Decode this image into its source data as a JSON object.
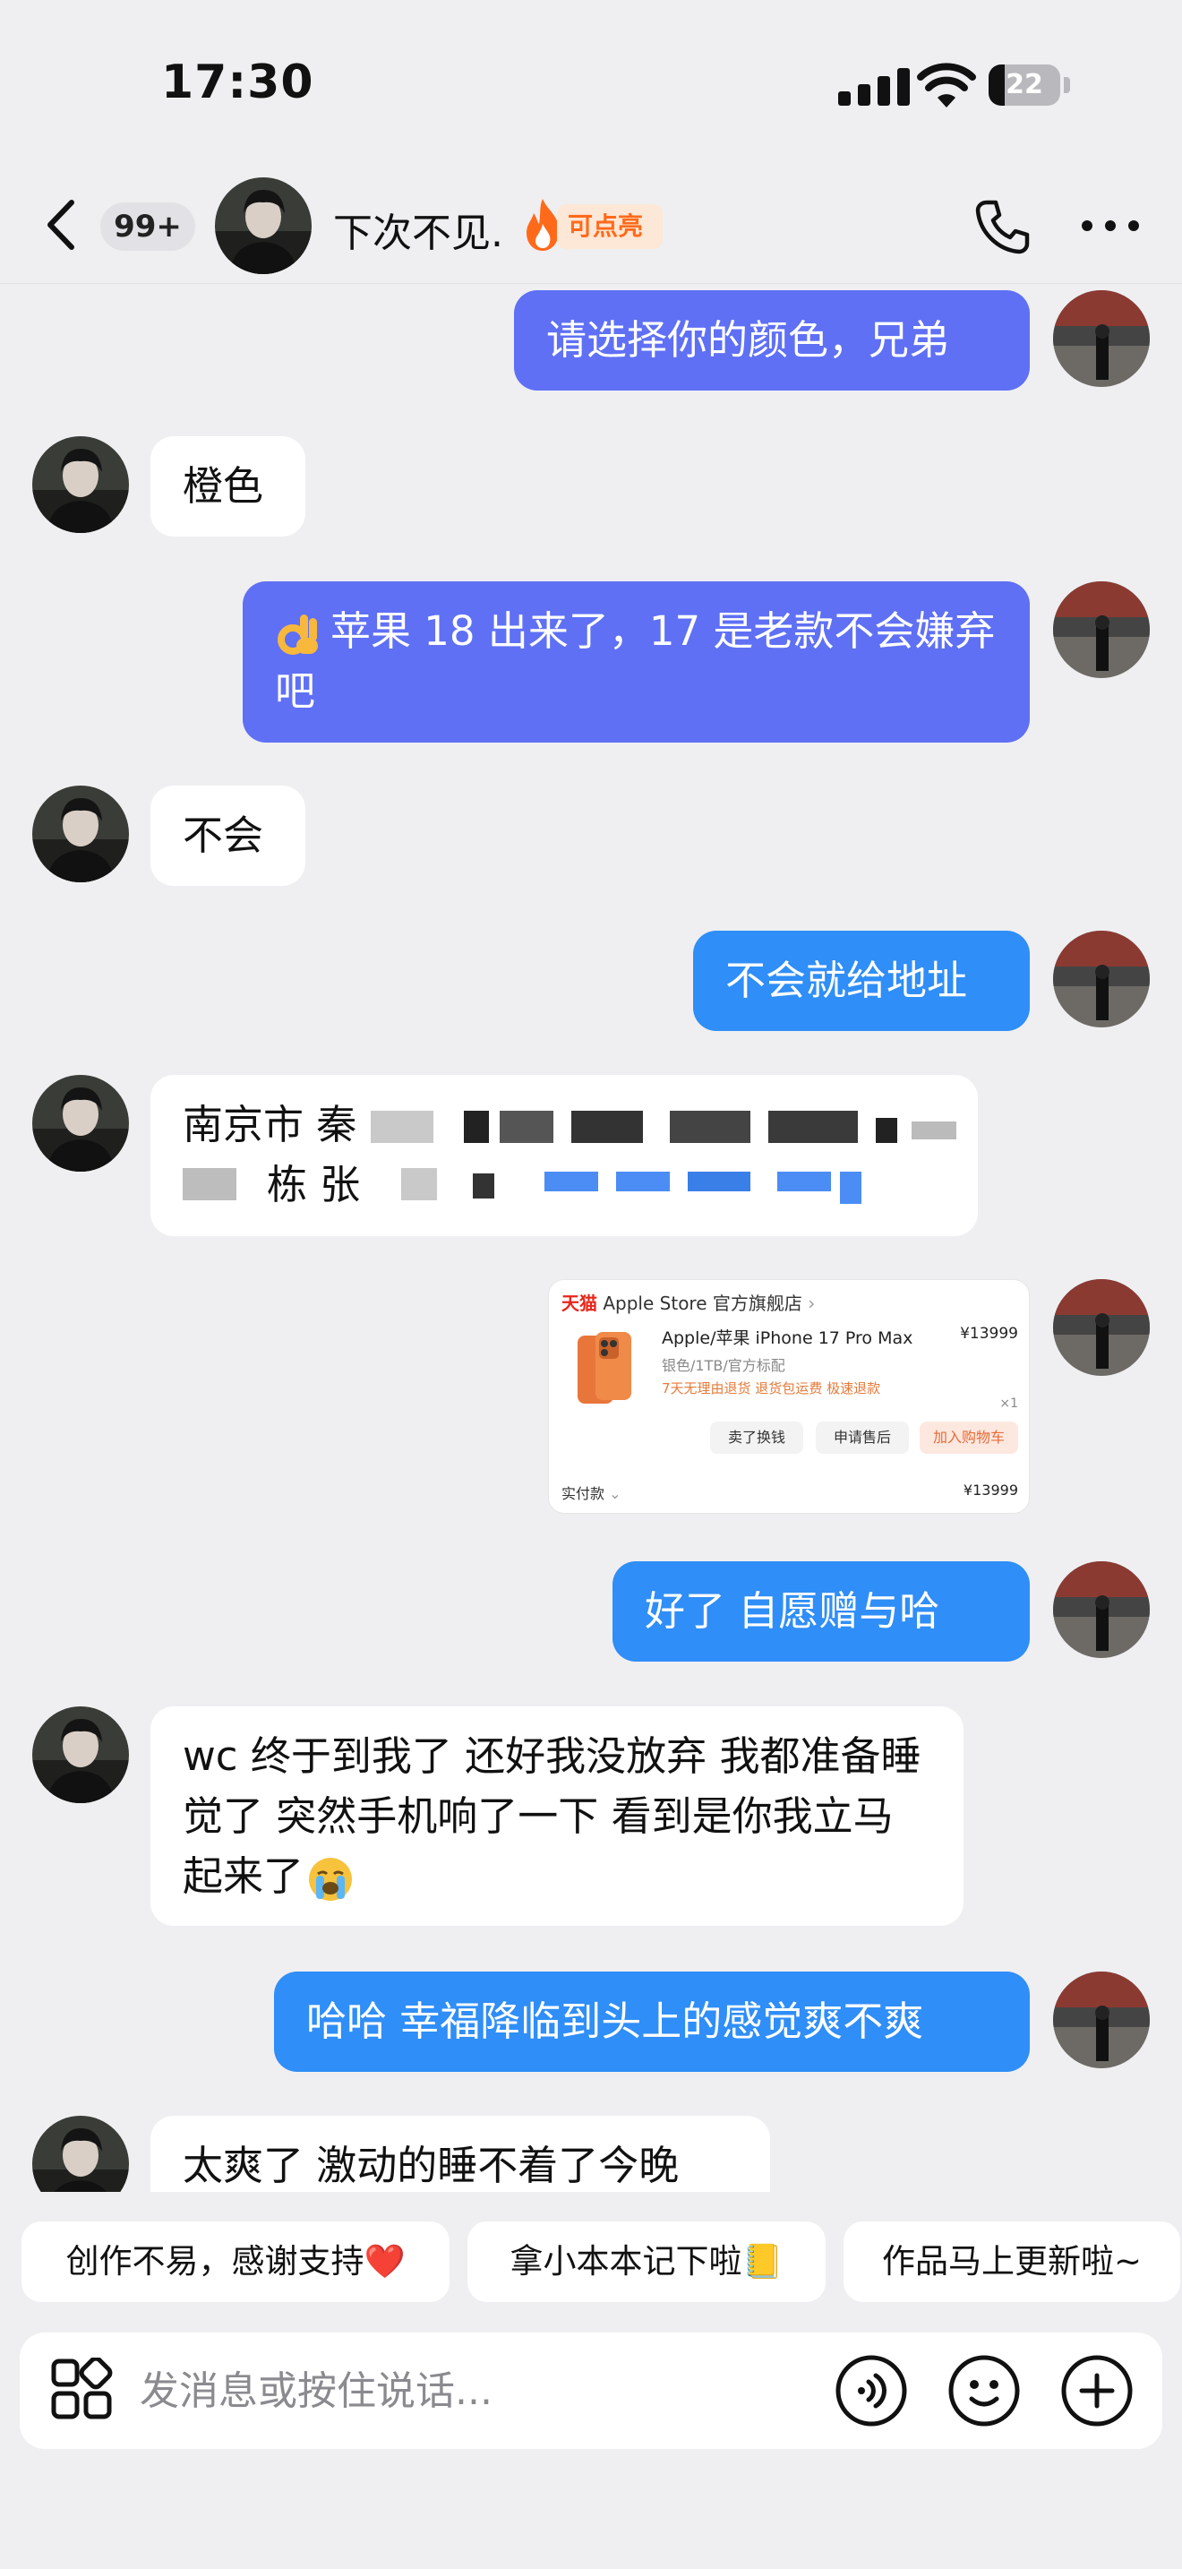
{
  "status_bar": {
    "time": "17:30",
    "battery": "22",
    "battery_level": 0.22
  },
  "header": {
    "unread_count": "99+",
    "contact_name": "下次不见.",
    "streak_label": "可点亮"
  },
  "messages": [
    {
      "side": "out",
      "text": "请选择你的颜色，兄弟"
    },
    {
      "side": "in",
      "text": "橙色"
    },
    {
      "side": "out",
      "emoji": "ok-hand",
      "text": "苹果 18 出来了，17 是老款不会嫌弃吧"
    },
    {
      "side": "in",
      "text": "不会"
    },
    {
      "side": "out",
      "text": "不会就给地址"
    },
    {
      "side": "in",
      "line1": "南京市 秦",
      "line2_a": "",
      "line2_b": "栋 张",
      "redacted": true
    },
    {
      "side": "out",
      "type": "product-card"
    },
    {
      "side": "out",
      "text": "好了 自愿赠与哈"
    },
    {
      "side": "in",
      "text": "wc 终于到我了 还好我没放弃 我都准备睡觉了 突然手机响了一下 看到是你我立马起来了",
      "emoji": "crying-face"
    },
    {
      "side": "out",
      "text": "哈哈 幸福降临到头上的感觉爽不爽"
    },
    {
      "side": "in",
      "text": "太爽了 激动的睡不着了今晚"
    }
  ],
  "product_card": {
    "platform": "天猫",
    "store": "Apple Store 官方旗舰店",
    "title": "Apple/苹果 iPhone 17 Pro Max",
    "price": "¥13999",
    "spec": "银色/1TB/官方标配",
    "tags": "7天无理由退货  退货包运费  极速退款",
    "qty": "×1",
    "btn_resell": "卖了换钱",
    "btn_aftersale": "申请售后",
    "btn_cart": "加入购物车",
    "paid_label": "实付款",
    "paid_price": "¥13999"
  },
  "quick_replies": [
    "创作不易，感谢支持❤️",
    "拿小本本记下啦📒",
    "作品马上更新啦~"
  ],
  "input": {
    "placeholder": "发消息或按住说话..."
  },
  "colors": {
    "out_purple": "#5f70f5",
    "out_blue": "#2f8ef7",
    "background": "#efeff1",
    "streak": "#ff6a1a"
  },
  "icons": [
    "back-icon",
    "fire-icon",
    "phone-icon",
    "more-icon",
    "apps-icon",
    "voice-icon",
    "emoji-icon",
    "plus-icon"
  ]
}
